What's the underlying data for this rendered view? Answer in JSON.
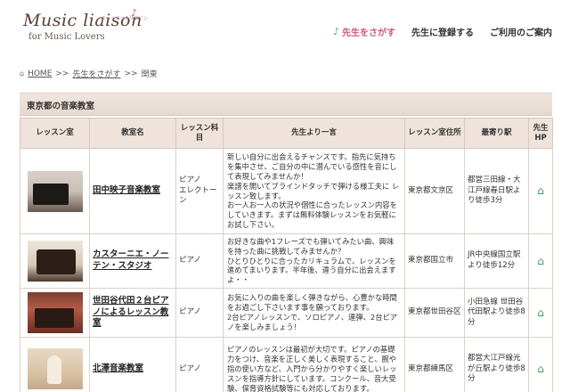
{
  "logo": {
    "main": "Music liaison",
    "tiny": "ミュージックリエゾン",
    "sub": "for Music Lovers"
  },
  "nav": {
    "items": [
      {
        "label": "先生をさがす",
        "active": true
      },
      {
        "label": "先生に登録する",
        "active": false
      },
      {
        "label": "ご利用のご案内",
        "active": false
      }
    ]
  },
  "breadcrumb": {
    "home": "HOME",
    "sep": ">>",
    "teacher": "先生をさがす",
    "current": "関東"
  },
  "section": {
    "title": "東京都の音楽教室"
  },
  "table": {
    "headers": {
      "photo": "レッスン室",
      "name": "教室名",
      "subject": "レッスン科目",
      "message": "先生より一言",
      "address": "レッスン室住所",
      "station": "最寄り駅",
      "hp": "先生HP"
    },
    "rows": [
      {
        "name": "田中映子音楽教室",
        "subject": "ピアノ\nエレクトーン",
        "message": "新しい自分に出会えるチャンスです。指先に気持ちを集中させ、ご自分の中に潜んでいる感性を音にして表現してみませんか！\n楽譜を開いてブラインドタッチで弾ける様工夫に レッスン致します。\nお一人お一人の状況や個性に合ったレッスン内容をしていきます。まずは無料体験レッスンをお気軽にお試し下さい。",
        "address": "東京都文京区",
        "station": "都営三田線・大江戸線春日駅より徒歩3分"
      },
      {
        "name": "カスターニエ・ノーテン・スタジオ",
        "subject": "ピアノ",
        "message": "お好きな曲や1フレーズでも弾いてみたい曲、興味を持った曲に挑戦してみませんか？\nひとりひとりに合ったカリキュラムで、レッスンを進めてまいります。半年後、違う自分に出会えますよ・・",
        "address": "東京都国立市",
        "station": "JR中央線国立駅より徒歩12分"
      },
      {
        "name": "世田谷代田２台ピアノによるレッスン教室",
        "subject": "ピアノ",
        "message": "お気に入りの曲を楽しく弾きながら、心豊かな時間をお過ごし下さいます事を願っております。\n2台ピアノレッスンで、ソロピアノ、連弾、2台ピアノを楽しみましょう！",
        "address": "東京都世田谷区",
        "station": "小田急線 世田谷代田駅より徒歩8分"
      },
      {
        "name": "北澤音楽教室",
        "subject": "ピアノ",
        "message": "ピアノのレッスンは最初が大切です。ピアノの基礎力をつけ、音楽を正しく美しく表現すること、腕や指の使い方など、入門から分かりやすく楽しいレッスンを指導方針にしています。コンクール、音大受験、保育資格試験等にも対応しております。",
        "address": "東京都練馬区",
        "station": "都営大江戸線光が丘駅より徒歩8分"
      }
    ]
  }
}
